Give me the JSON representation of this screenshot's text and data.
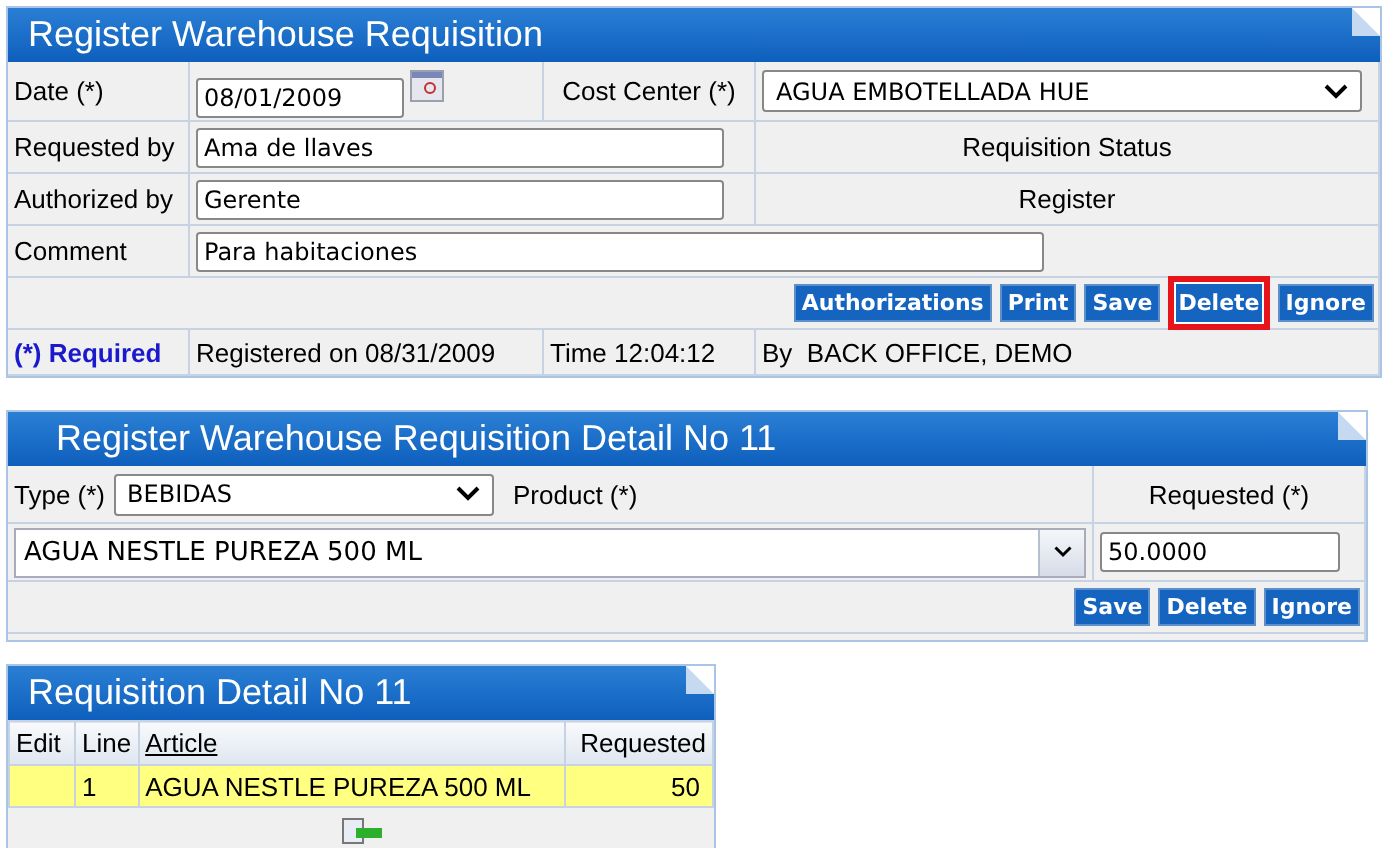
{
  "requisition": {
    "title": "Register Warehouse Requisition",
    "date": {
      "label": "Date (*)",
      "value": "08/01/2009"
    },
    "cost_center": {
      "label": "Cost Center (*)",
      "value": "AGUA EMBOTELLADA HUE"
    },
    "requested_by": {
      "label": "Requested by",
      "value": "Ama de llaves"
    },
    "status_label": "Requisition Status",
    "authorized_by": {
      "label": "Authorized by",
      "value": "Gerente"
    },
    "status_value": "Register",
    "comment": {
      "label": "Comment",
      "value": "Para habitaciones"
    },
    "buttons": [
      {
        "label": "Authorizations",
        "highlighted": false
      },
      {
        "label": "Print",
        "highlighted": false
      },
      {
        "label": "Save",
        "highlighted": false
      },
      {
        "label": "Delete",
        "highlighted": true
      },
      {
        "label": "Ignore",
        "highlighted": false
      }
    ],
    "footer": {
      "required": "(*) Required",
      "registered": "Registered on 08/31/2009",
      "time": "Time 12:04:12",
      "by": "By  BACK OFFICE, DEMO"
    }
  },
  "detail": {
    "title": "Register Warehouse Requisition Detail No 11",
    "type": {
      "label": "Type (*)",
      "value": "BEBIDAS"
    },
    "product_label": "Product (*)",
    "requested_label": "Requested (*)",
    "product": {
      "value": "AGUA NESTLE PUREZA 500 ML"
    },
    "requested": {
      "value": "50.0000"
    },
    "buttons": [
      {
        "label": "Save"
      },
      {
        "label": "Delete"
      },
      {
        "label": "Ignore"
      }
    ]
  },
  "list": {
    "title": "Requisition Detail No 11",
    "columns": [
      "Edit",
      "Line",
      "Article",
      "Requested"
    ],
    "rows": [
      {
        "cells": [
          "",
          "1",
          "AGUA NESTLE PUREZA 500 ML",
          "50"
        ],
        "selected": true
      }
    ]
  }
}
